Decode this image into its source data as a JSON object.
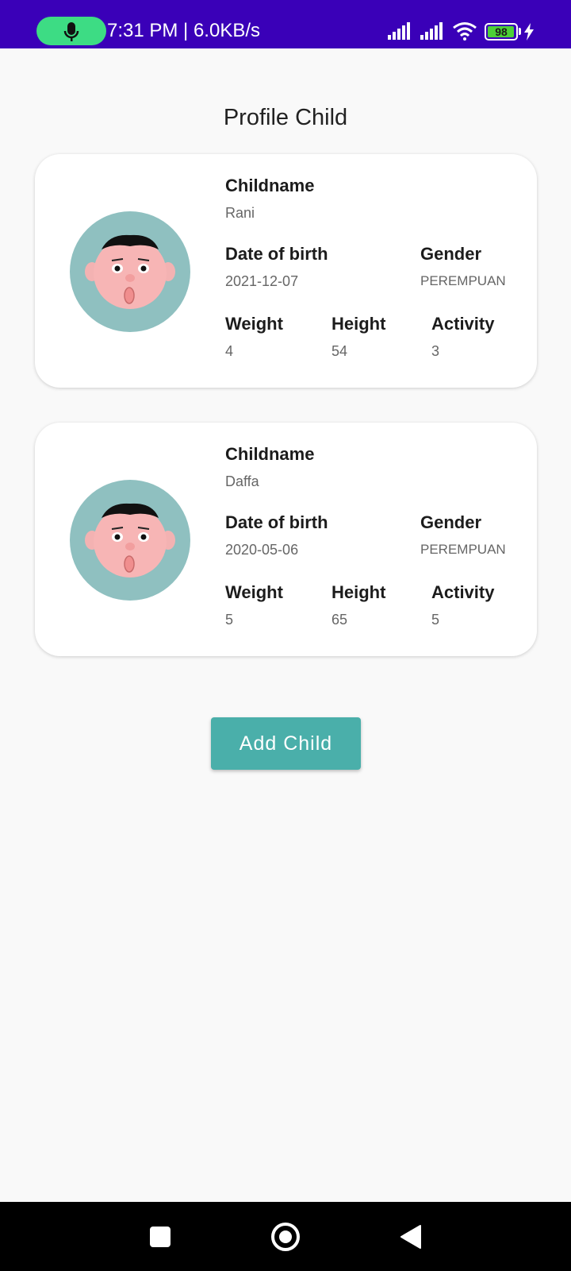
{
  "status_bar": {
    "time_speed": "7:31 PM | 6.0KB/s",
    "battery_level": "98",
    "battery_percent": 98,
    "icons": [
      "mic-icon",
      "signal-icon",
      "signal-icon",
      "wifi-icon",
      "battery-icon",
      "charging-bolt-icon"
    ]
  },
  "page": {
    "title": "Profile Child"
  },
  "children": [
    {
      "name_label": "Childname",
      "name": "Rani",
      "dob_label": "Date of birth",
      "dob": "2021-12-07",
      "gender_label": "Gender",
      "gender": "PEREMPUAN",
      "weight_label": "Weight",
      "weight": "4",
      "height_label": "Height",
      "height": "54",
      "activity_label": "Activity",
      "activity": "3"
    },
    {
      "name_label": "Childname",
      "name": "Daffa",
      "dob_label": "Date of birth",
      "dob": "2020-05-06",
      "gender_label": "Gender",
      "gender": "PEREMPUAN",
      "weight_label": "Weight",
      "weight": "5",
      "height_label": "Height",
      "height": "65",
      "activity_label": "Activity",
      "activity": "5"
    }
  ],
  "actions": {
    "add_child_label": "Add Child"
  },
  "nav": {
    "icons": [
      "recents-square-icon",
      "home-circle-icon",
      "back-triangle-icon"
    ]
  },
  "colors": {
    "status_bar": "#3a00b8",
    "accent_button": "#4aafaa",
    "avatar_bg": "#8fc0c0",
    "mic_pill": "#3ddc84"
  }
}
